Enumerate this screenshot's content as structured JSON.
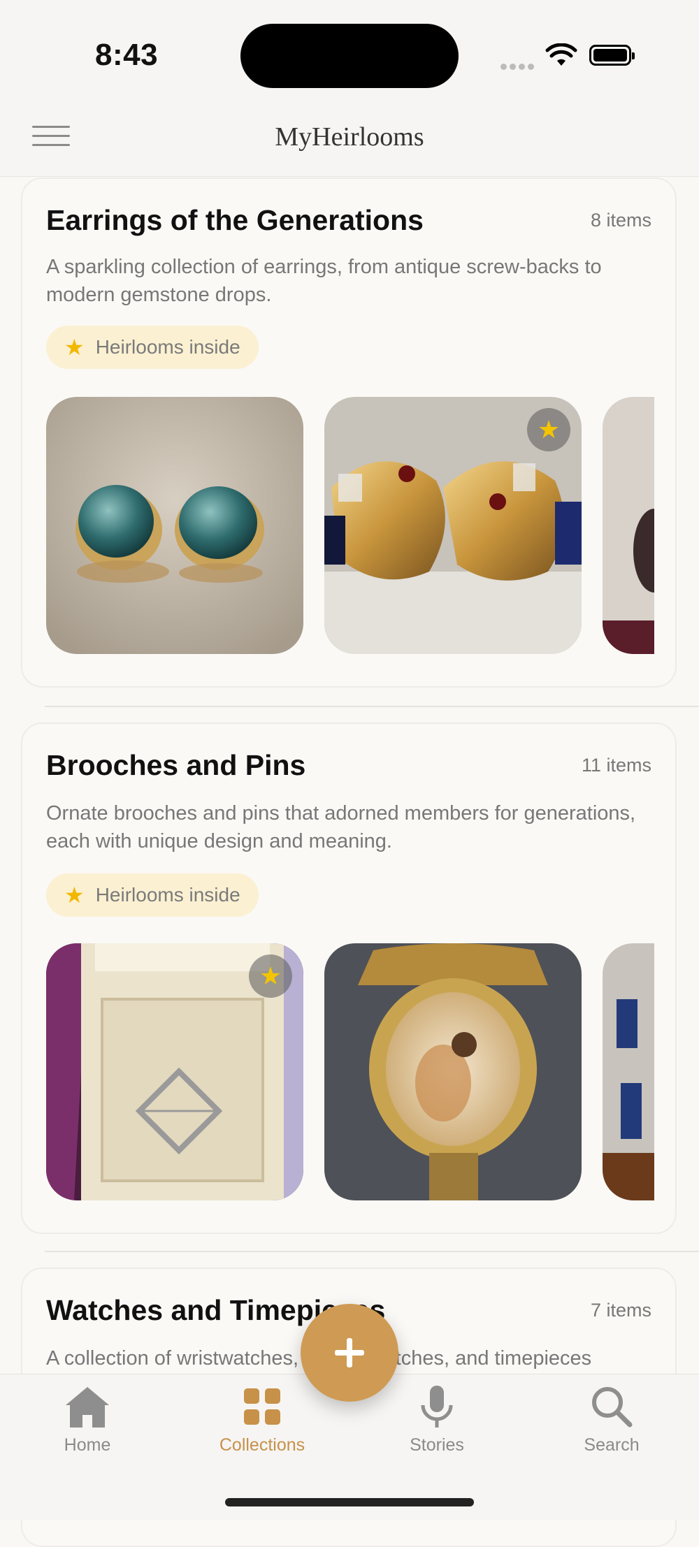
{
  "status": {
    "time": "8:43"
  },
  "header": {
    "title": "MyHeirlooms"
  },
  "collections": [
    {
      "title": "Earrings of the Generations",
      "count": "8 items",
      "description": "A sparkling collection of earrings, from antique screw-backs to modern gemstone drops.",
      "badge": "Heirlooms inside"
    },
    {
      "title": "Brooches and Pins",
      "count": "11 items",
      "description": "Ornate brooches and pins that adorned members for generations, each with unique design and meaning.",
      "badge": "Heirlooms inside"
    },
    {
      "title": "Watches and Timepieces",
      "count": "7 items",
      "description": "A collection of wristwatches, pocket watches, and timepieces"
    }
  ],
  "tabs": [
    {
      "label": "Home",
      "icon": "home-icon"
    },
    {
      "label": "Collections",
      "icon": "grid-icon"
    },
    {
      "label": "Stories",
      "icon": "microphone-icon"
    },
    {
      "label": "Search",
      "icon": "search-icon"
    }
  ],
  "colors": {
    "accent": "#c7914a",
    "fab": "#cf9a54",
    "badge_bg": "#fbf0d2",
    "star": "#f2b800"
  }
}
